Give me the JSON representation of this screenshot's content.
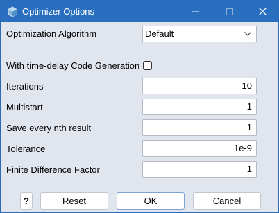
{
  "window": {
    "title": "Optimizer Options",
    "app_icon": "optimizer-icon",
    "controls": {
      "minimize": "minimize-icon",
      "maximize": "maximize-icon",
      "close": "close-icon"
    }
  },
  "form": {
    "algorithm": {
      "label": "Optimization Algorithm",
      "value": "Default"
    },
    "time_delay": {
      "label": "With time-delay Code Generation",
      "checked": false
    },
    "iterations": {
      "label": "Iterations",
      "value": "10"
    },
    "multistart": {
      "label": "Multistart",
      "value": "1"
    },
    "save_every": {
      "label": "Save every nth result",
      "value": "1"
    },
    "tolerance": {
      "label": "Tolerance",
      "value": "1e-9"
    },
    "finite_diff": {
      "label": "Finite Difference Factor",
      "value": "1"
    }
  },
  "buttons": {
    "help": "?",
    "reset": "Reset",
    "ok": "OK",
    "cancel": "Cancel"
  },
  "colors": {
    "titlebar": "#2a6ebf",
    "background": "#e1e5ee"
  }
}
